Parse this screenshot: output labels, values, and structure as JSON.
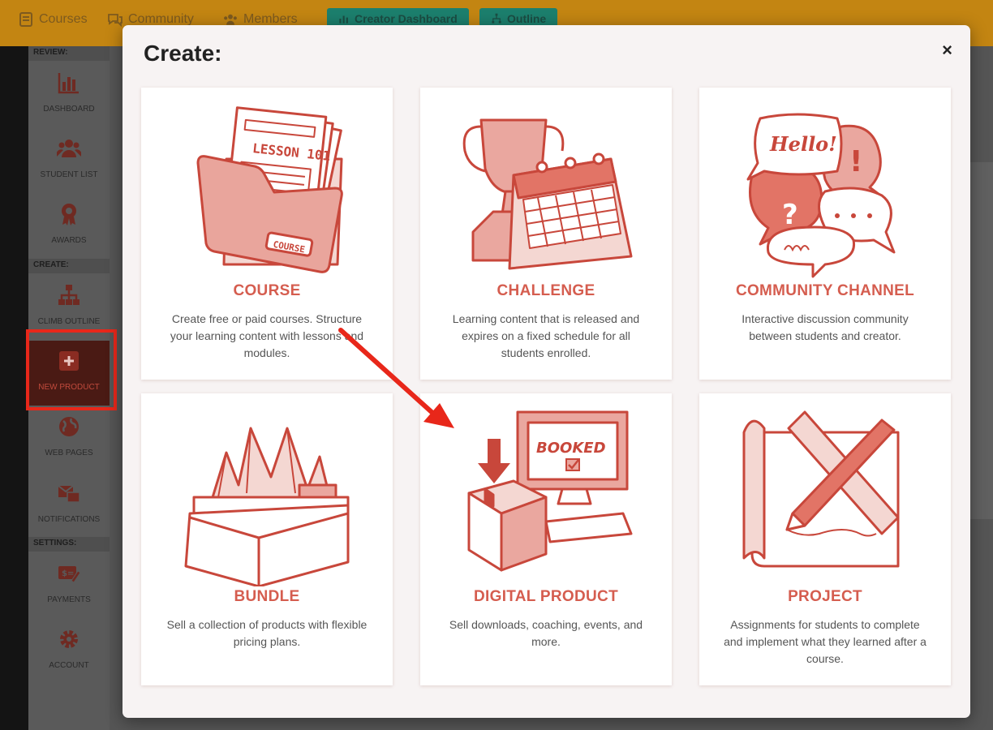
{
  "topbar": {
    "nav": [
      {
        "label": "Courses",
        "icon": "document-icon"
      },
      {
        "label": "Community",
        "icon": "chat-icon"
      },
      {
        "label": "Members",
        "icon": "members-icon"
      }
    ],
    "buttons": [
      {
        "label": "Creator Dashboard",
        "icon": "bar-chart-icon"
      },
      {
        "label": "Outline",
        "icon": "sitemap-icon"
      }
    ]
  },
  "sidebar": {
    "sections": {
      "review": "REVIEW:",
      "create": "CREATE:",
      "settings": "SETTINGS:"
    },
    "items": [
      {
        "label": "DASHBOARD",
        "icon": "bar-chart-icon"
      },
      {
        "label": "STUDENT LIST",
        "icon": "users-icon"
      },
      {
        "label": "AWARDS",
        "icon": "award-icon"
      },
      {
        "label": "CLIMB OUTLINE",
        "icon": "sitemap-icon"
      },
      {
        "label": "NEW PRODUCT",
        "icon": "plus-square-icon"
      },
      {
        "label": "WEB PAGES",
        "icon": "globe-icon"
      },
      {
        "label": "NOTIFICATIONS",
        "icon": "notifications-icon"
      },
      {
        "label": "PAYMENTS",
        "icon": "payments-icon"
      },
      {
        "label": "ACCOUNT",
        "icon": "gear-icon"
      }
    ]
  },
  "modal": {
    "title": "Create:",
    "close": "×",
    "cards": [
      {
        "title": "COURSE",
        "description": "Create free or paid courses. Structure your learning content with lessons and modules.",
        "art": "folder-lessons-illustration"
      },
      {
        "title": "CHALLENGE",
        "description": "Learning content that is released and expires on a fixed schedule for all students enrolled.",
        "art": "trophy-calendar-illustration"
      },
      {
        "title": "COMMUNITY CHANNEL",
        "description": "Interactive discussion community between students and creator.",
        "art": "speech-bubbles-illustration"
      },
      {
        "title": "BUNDLE",
        "description": "Sell a collection of products with flexible pricing plans.",
        "art": "box-bundle-illustration"
      },
      {
        "title": "DIGITAL PRODUCT",
        "description": "Sell downloads, coaching, events, and more.",
        "art": "computer-package-illustration"
      },
      {
        "title": "PROJECT",
        "description": "Assignments for students to complete and implement what they learned after a course.",
        "art": "blueprint-pencil-illustration"
      }
    ],
    "art_text": {
      "lesson": "LESSON 101",
      "course": "COURSE",
      "hello": "Hello!",
      "booked": "BOOKED"
    }
  },
  "colors": {
    "accent": "#d55d4f",
    "topbar": "#c38512",
    "highlight": "#e8271a"
  }
}
